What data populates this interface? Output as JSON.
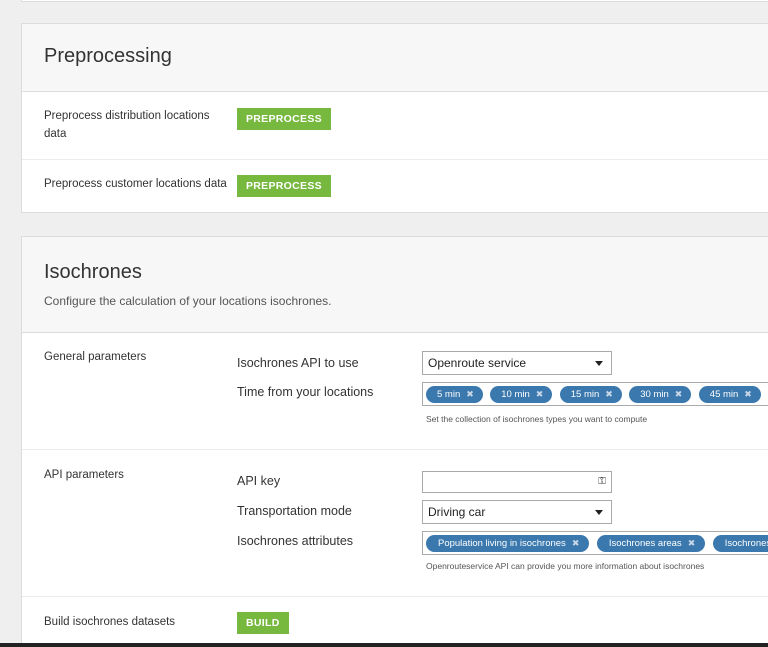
{
  "preprocessing": {
    "title": "Preprocessing",
    "rows": [
      {
        "label": "Preprocess distribution locations data",
        "button": "PREPROCESS"
      },
      {
        "label": "Preprocess customer locations data",
        "button": "PREPROCESS"
      }
    ]
  },
  "isochrones": {
    "title": "Isochrones",
    "description": "Configure the calculation of your locations isochrones.",
    "general": {
      "label": "General parameters",
      "api_label": "Isochrones API to use",
      "api_value": "Openroute service",
      "time_label": "Time from your locations",
      "time_tags": [
        "5 min",
        "10 min",
        "15 min",
        "30 min",
        "45 min"
      ],
      "time_help": "Set the collection of isochrones types you want to compute"
    },
    "api": {
      "label": "API parameters",
      "key_label": "API key",
      "key_value": "",
      "mode_label": "Transportation mode",
      "mode_value": "Driving car",
      "attr_label": "Isochrones attributes",
      "attr_tags": [
        "Population living in isochrones",
        "Isochrones areas",
        "Isochrones"
      ],
      "attr_help": "Openrouteservice API can provide you more information about isochrones"
    },
    "build": {
      "label": "Build isochrones datasets",
      "button": "BUILD"
    }
  },
  "icons": {
    "remove": "✖",
    "dropdown": "caret-down",
    "key": "key-icon"
  },
  "colors": {
    "green_button": "#77b83f",
    "tag_blue": "#3a78ad"
  }
}
